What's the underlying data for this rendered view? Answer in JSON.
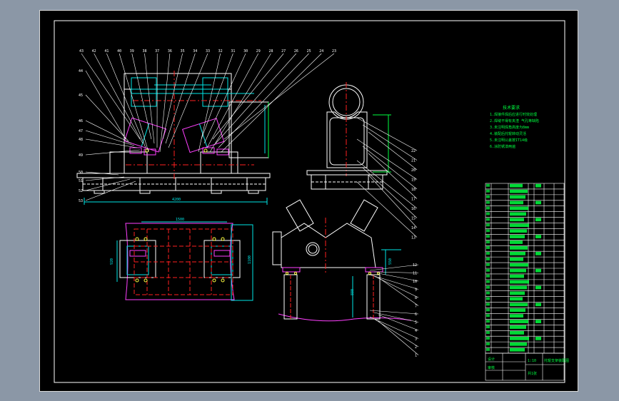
{
  "viewport": {
    "background": "#8b97a6",
    "sheet_background": "#000000"
  },
  "colors": {
    "frame": "#ffffff",
    "outline": "#ffffff",
    "center_line": "#ff2020",
    "dimension": "#00e6e6",
    "section": "#ff40ff",
    "note": "#00ff40",
    "hidden": "#ffff40"
  },
  "notes": {
    "title": "技术要求",
    "lines": [
      "1.焊接件焊后应进行时效处理",
      "2.焊缝不得有夹渣 气孔等缺陷",
      "3.未注明焊角高度为8mm",
      "4.装配后托辊转动灵活",
      "5.未注明公差按IT14级",
      "6.涂防锈漆两遍"
    ]
  },
  "dimensions": {
    "front_length": "4200",
    "plan_width": "1500",
    "plan_height": "920",
    "plan_side": "1100",
    "side_height": "1570",
    "end_height": "550",
    "end_post": "880"
  },
  "balloons": {
    "front_top": [
      "43",
      "42",
      "41",
      "40",
      "39",
      "38",
      "37",
      "36",
      "35",
      "34",
      "33",
      "32",
      "31",
      "30",
      "29",
      "28",
      "27",
      "26",
      "25",
      "24",
      "23"
    ],
    "front_left": [
      "44",
      "45",
      "46",
      "47",
      "48",
      "49",
      "50",
      "51",
      "52",
      "53"
    ],
    "side_right": [
      "22",
      "21",
      "20",
      "19",
      "18",
      "17",
      "16",
      "15",
      "14",
      "13"
    ],
    "end_right": [
      "12",
      "11",
      "10",
      "9",
      "8",
      "7",
      "6",
      "5",
      "4",
      "3",
      "2",
      "1"
    ]
  },
  "bom": {
    "rows": 30,
    "header": "明细表",
    "sample_text": "Q235"
  },
  "title_block": {
    "drawing_name": "托辊支架装配图",
    "scale": "1:10",
    "sheet": "共1张",
    "designer": "设计",
    "checker": "审核"
  }
}
